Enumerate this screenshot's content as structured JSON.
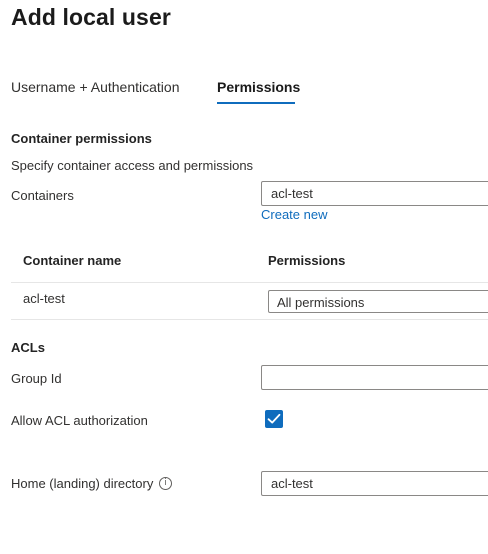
{
  "page": {
    "title": "Add local user"
  },
  "tabs": [
    {
      "label": "Username + Authentication",
      "selected": false
    },
    {
      "label": "Permissions",
      "selected": true
    }
  ],
  "container_permissions": {
    "heading": "Container permissions",
    "description": "Specify container access and permissions",
    "containers_label": "Containers",
    "containers_value": "acl-test",
    "create_new_link": "Create new",
    "table": {
      "headers": [
        "Container name",
        "Permissions"
      ],
      "rows": [
        {
          "container_name": "acl-test",
          "permissions": "All permissions"
        }
      ]
    }
  },
  "acls": {
    "heading": "ACLs",
    "group_id_label": "Group Id",
    "group_id_value": "",
    "allow_acl_label": "Allow ACL authorization",
    "allow_acl_checked": true
  },
  "home_directory": {
    "label": "Home (landing) directory",
    "info_icon": "info-icon",
    "info_glyph": "i",
    "value": "acl-test"
  },
  "colors": {
    "accent": "#0f6cbd",
    "text": "#242424",
    "border": "#8a8886"
  }
}
